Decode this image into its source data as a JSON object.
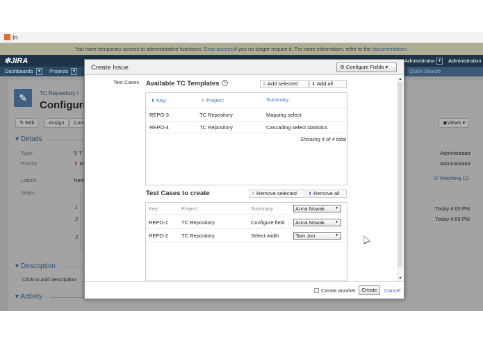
{
  "browser": {
    "tab_title": "In"
  },
  "banner": {
    "text_before": "You have temporary access to administrative functions.",
    "drop_link": "Drop access",
    "text_middle": "if you no longer require it. For more information, refer to the",
    "doc_link": "documentation",
    "text_after": "."
  },
  "header": {
    "logo": "JIRA",
    "user": "Administrator",
    "admin": "Administration",
    "nav": [
      "Dashboards",
      "Projects"
    ],
    "quick_search_placeholder": "Quick Search"
  },
  "issue": {
    "breadcrumb": "TC Repository /",
    "title_partial": "Configure",
    "ops": [
      "Edit",
      "Assign",
      "Com"
    ],
    "views_label": "Views",
    "details_title": "Details",
    "type_label": "Type:",
    "priority_label": "Priority:",
    "labels_label": "Labels:",
    "labels_value": "None",
    "steps_label": "Steps:",
    "type_partial": "T",
    "priority_partial": "M",
    "steps": [
      "1",
      "2",
      "3"
    ],
    "assignee": "Administrator",
    "reporter": "Administrator",
    "watching": "Watching (1)",
    "created": "Today 4:00 PM",
    "updated": "Today 4:00 PM",
    "description_title": "Description",
    "description_placeholder": "Click to add description",
    "activity_title": "Activity"
  },
  "modal": {
    "title": "Create Issue",
    "configure_fields": "Configure Fields",
    "field_label": "Test Cases",
    "available": {
      "title": "Available TC Templates",
      "add_selected": "Add selected",
      "add_all": "Add all",
      "columns": [
        "Key:",
        "Project:",
        "Summary:"
      ],
      "rows": [
        {
          "key": "REPO-3",
          "project": "TC Repository",
          "summary": "Mapping select"
        },
        {
          "key": "REPO-4",
          "project": "TC Repository",
          "summary": "Cascading select statistics"
        }
      ],
      "showing": "Showing 4 of 4 total"
    },
    "to_create": {
      "title": "Test Cases to create",
      "remove_selected": "Remove selected",
      "remove_all": "Remove all",
      "columns": [
        "Key",
        "Project",
        "Summary"
      ],
      "header_assignee": "Anna Nowak",
      "rows": [
        {
          "key": "REPO-1",
          "project": "TC Repository",
          "summary": "Configure field",
          "assignee": "Anna Nowak"
        },
        {
          "key": "REPO-2",
          "project": "TC Repository",
          "summary": "Select width",
          "assignee": "Tom Jon"
        }
      ]
    },
    "create_another": "Create another",
    "create": "Create",
    "cancel": "Cancel"
  },
  "colors": {
    "link": "#3a6eb5",
    "header": "#1f3449",
    "nav": "#2c4a66"
  }
}
